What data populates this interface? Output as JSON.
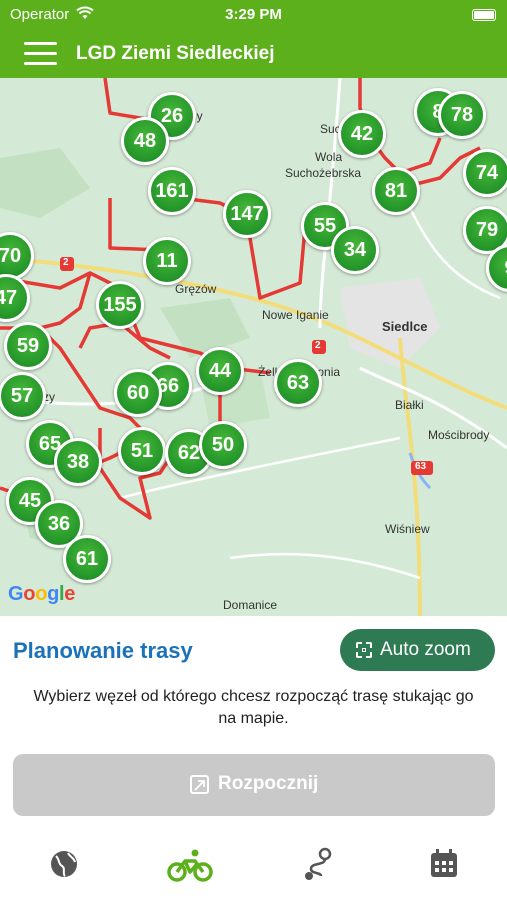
{
  "status": {
    "carrier": "Operator",
    "time": "3:29 PM"
  },
  "header": {
    "title": "LGD Ziemi Siedleckiej"
  },
  "map": {
    "route_color": "#e53935",
    "node_color": "#24952a",
    "place_labels": [
      {
        "id": "nazy",
        "text": "ny",
        "city": false
      },
      {
        "id": "suchozebry",
        "text": "Suchożebry",
        "city": false
      },
      {
        "id": "wola",
        "text": "Wola",
        "city": false
      },
      {
        "id": "wola2",
        "text": "Suchożebrska",
        "city": false
      },
      {
        "id": "grezow",
        "text": "Gręzów",
        "city": false
      },
      {
        "id": "nowe-iganie",
        "text": "Nowe Iganie",
        "city": false
      },
      {
        "id": "siedlce",
        "text": "Siedlce",
        "city": true
      },
      {
        "id": "zelkow",
        "text": "Żelków-Kolonia",
        "city": false
      },
      {
        "id": "zy",
        "text": "zy",
        "city": false
      },
      {
        "id": "bialki",
        "text": "Białki",
        "city": false
      },
      {
        "id": "moscibrody",
        "text": "Mościbrody",
        "city": false
      },
      {
        "id": "wisniew",
        "text": "Wiśniew",
        "city": false
      },
      {
        "id": "domanice",
        "text": "Domanice",
        "city": false
      }
    ],
    "road_badges": [
      "2",
      "2",
      "63"
    ],
    "nodes": [
      {
        "id": "n8",
        "label": "8"
      },
      {
        "id": "n78",
        "label": "78"
      },
      {
        "id": "n26",
        "label": "26"
      },
      {
        "id": "n48",
        "label": "48"
      },
      {
        "id": "n42",
        "label": "42"
      },
      {
        "id": "n74",
        "label": "74"
      },
      {
        "id": "n161",
        "label": "161"
      },
      {
        "id": "n81",
        "label": "81"
      },
      {
        "id": "n147",
        "label": "147"
      },
      {
        "id": "n55",
        "label": "55"
      },
      {
        "id": "n34",
        "label": "34"
      },
      {
        "id": "n79",
        "label": "79"
      },
      {
        "id": "n70",
        "label": "70"
      },
      {
        "id": "n11",
        "label": "11"
      },
      {
        "id": "n9",
        "label": "9"
      },
      {
        "id": "n47",
        "label": "47"
      },
      {
        "id": "n155",
        "label": "155"
      },
      {
        "id": "n59",
        "label": "59"
      },
      {
        "id": "n44",
        "label": "44"
      },
      {
        "id": "n66",
        "label": "66"
      },
      {
        "id": "n63",
        "label": "63"
      },
      {
        "id": "n60",
        "label": "60"
      },
      {
        "id": "n57",
        "label": "57"
      },
      {
        "id": "n65",
        "label": "65"
      },
      {
        "id": "n51",
        "label": "51"
      },
      {
        "id": "n62",
        "label": "62"
      },
      {
        "id": "n50",
        "label": "50"
      },
      {
        "id": "n38",
        "label": "38"
      },
      {
        "id": "n45",
        "label": "45"
      },
      {
        "id": "n36",
        "label": "36"
      },
      {
        "id": "n61",
        "label": "61"
      }
    ],
    "attribution": "Google"
  },
  "panel": {
    "title": "Planowanie trasy",
    "auto_zoom_label": "Auto zoom",
    "hint": "Wybierz węzeł od którego chcesz rozpocząć trasę stukając go na mapie.",
    "start_label": "Rozpocznij"
  },
  "tabs": [
    {
      "id": "map",
      "icon": "globe-icon",
      "active": false
    },
    {
      "id": "bike",
      "icon": "bicycle-icon",
      "active": true
    },
    {
      "id": "route",
      "icon": "route-icon",
      "active": false
    },
    {
      "id": "calendar",
      "icon": "calendar-icon",
      "active": false
    }
  ],
  "colors": {
    "brand": "#5cb01c",
    "accent_blue": "#1b72ba",
    "button_green": "#2e7a52",
    "disabled": "#c9c9c9"
  }
}
